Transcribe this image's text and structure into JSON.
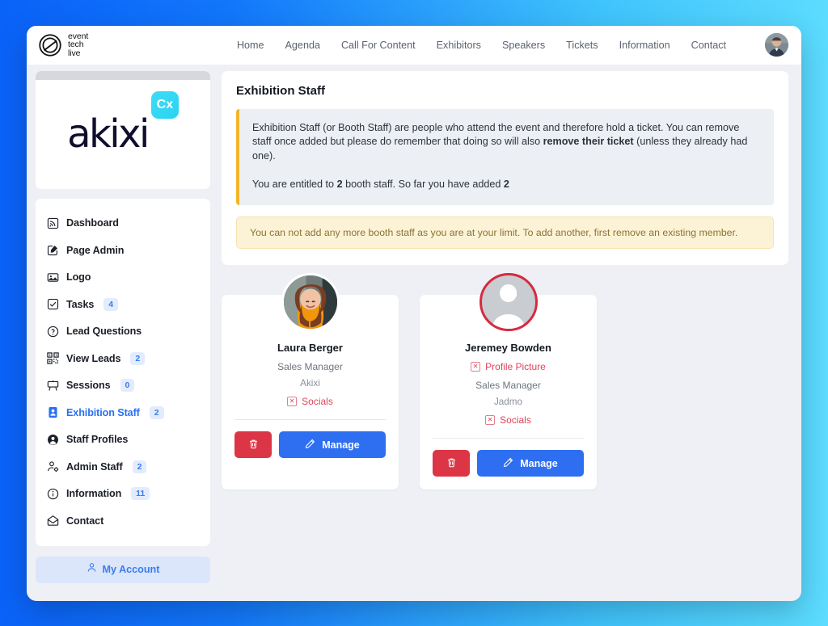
{
  "brand": {
    "line1": "event",
    "line2": "tech",
    "line3": "live"
  },
  "topnav": {
    "links": [
      {
        "label": "Home"
      },
      {
        "label": "Agenda"
      },
      {
        "label": "Call For Content"
      },
      {
        "label": "Exhibitors"
      },
      {
        "label": "Speakers"
      },
      {
        "label": "Tickets"
      },
      {
        "label": "Information"
      },
      {
        "label": "Contact"
      }
    ]
  },
  "sidebar": {
    "logo": {
      "word": "akixi",
      "badge": "Cx"
    },
    "items": [
      {
        "label": "Dashboard",
        "icon": "rss-icon",
        "badge": null,
        "active": false
      },
      {
        "label": "Page Admin",
        "icon": "pencil-square-icon",
        "badge": null,
        "active": false
      },
      {
        "label": "Logo",
        "icon": "image-icon",
        "badge": null,
        "active": false
      },
      {
        "label": "Tasks",
        "icon": "checkbox-icon",
        "badge": "4",
        "active": false
      },
      {
        "label": "Lead Questions",
        "icon": "question-circle-icon",
        "badge": null,
        "active": false
      },
      {
        "label": "View Leads",
        "icon": "qr-code-icon",
        "badge": "2",
        "active": false
      },
      {
        "label": "Sessions",
        "icon": "easel-icon",
        "badge": "0",
        "active": false
      },
      {
        "label": "Exhibition Staff",
        "icon": "id-card-icon",
        "badge": "2",
        "active": true
      },
      {
        "label": "Staff Profiles",
        "icon": "person-circle-icon",
        "badge": null,
        "active": false
      },
      {
        "label": "Admin Staff",
        "icon": "person-gear-icon",
        "badge": "2",
        "active": false
      },
      {
        "label": "Information",
        "icon": "info-circle-icon",
        "badge": "11",
        "active": false
      },
      {
        "label": "Contact",
        "icon": "envelope-open-icon",
        "badge": null,
        "active": false
      }
    ],
    "account_button": {
      "label": "My Account",
      "icon": "person-icon"
    }
  },
  "main": {
    "page_title": "Exhibition Staff",
    "info": {
      "para1_a": "Exhibition Staff (or Booth Staff) are people who attend the event and therefore hold a ticket. You can remove staff once added but please do remember that doing so will also ",
      "para1_bold": "remove their ticket",
      "para1_b": " (unless they already had one).",
      "para2_a": "You are entitled to ",
      "para2_bold1": "2",
      "para2_b": " booth staff. So far you have added ",
      "para2_bold2": "2"
    },
    "warning": "You can not add any more booth staff as you are at your limit. To add another, first remove an existing member.",
    "staff": [
      {
        "name": "Laura Berger",
        "missing_picture": false,
        "missing_picture_label": "Profile Picture",
        "role": "Sales Manager",
        "company": "Akixi",
        "socials_label": "Socials",
        "delete_icon": "trash-icon",
        "manage_label": "Manage",
        "manage_icon": "pencil-icon"
      },
      {
        "name": "Jeremey Bowden",
        "missing_picture": true,
        "missing_picture_label": "Profile Picture",
        "role": "Sales Manager",
        "company": "Jadmo",
        "socials_label": "Socials",
        "delete_icon": "trash-icon",
        "manage_label": "Manage",
        "manage_icon": "pencil-icon"
      }
    ]
  },
  "colors": {
    "accent_blue": "#2e6ef0",
    "danger_red": "#dc3545",
    "flag_red": "#df4259",
    "warning_amber": "#f2b429",
    "badge_bg": "#e3ecfd",
    "logo_badge_cyan": "#2ed3f2"
  }
}
